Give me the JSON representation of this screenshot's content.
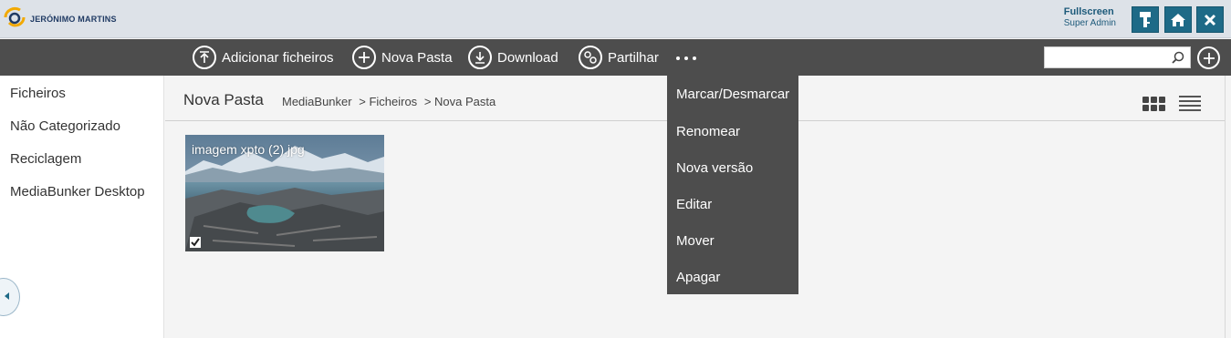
{
  "header": {
    "logo_text": "JERÓNIMO MARTINS",
    "fullscreen_label": "Fullscreen",
    "user_name": "Super Admin"
  },
  "toolbar": {
    "add_files_label": "Adicionar ficheiros",
    "new_folder_label": "Nova Pasta",
    "download_label": "Download",
    "share_label": "Partilhar",
    "search_placeholder": ""
  },
  "sidebar": {
    "items": [
      {
        "label": "Ficheiros"
      },
      {
        "label": "Não Categorizado"
      },
      {
        "label": "Reciclagem"
      },
      {
        "label": "MediaBunker Desktop"
      }
    ]
  },
  "main": {
    "title": "Nova Pasta",
    "breadcrumb": [
      "MediaBunker",
      "> Ficheiros",
      "> Nova Pasta"
    ]
  },
  "files": [
    {
      "name": "imagem xpto (2).jpg",
      "checked": true
    }
  ],
  "more_menu": {
    "items": [
      {
        "label": "Marcar/Desmarcar"
      },
      {
        "label": "Renomear"
      },
      {
        "label": "Nova versão"
      },
      {
        "label": "Editar"
      },
      {
        "label": "Mover"
      },
      {
        "label": "Apagar"
      }
    ]
  },
  "colors": {
    "topbar_bg": "#dde2e8",
    "toolbar_bg": "#4d4d4d",
    "accent_button": "#1e6a87",
    "text_link": "#1d5a7a"
  }
}
